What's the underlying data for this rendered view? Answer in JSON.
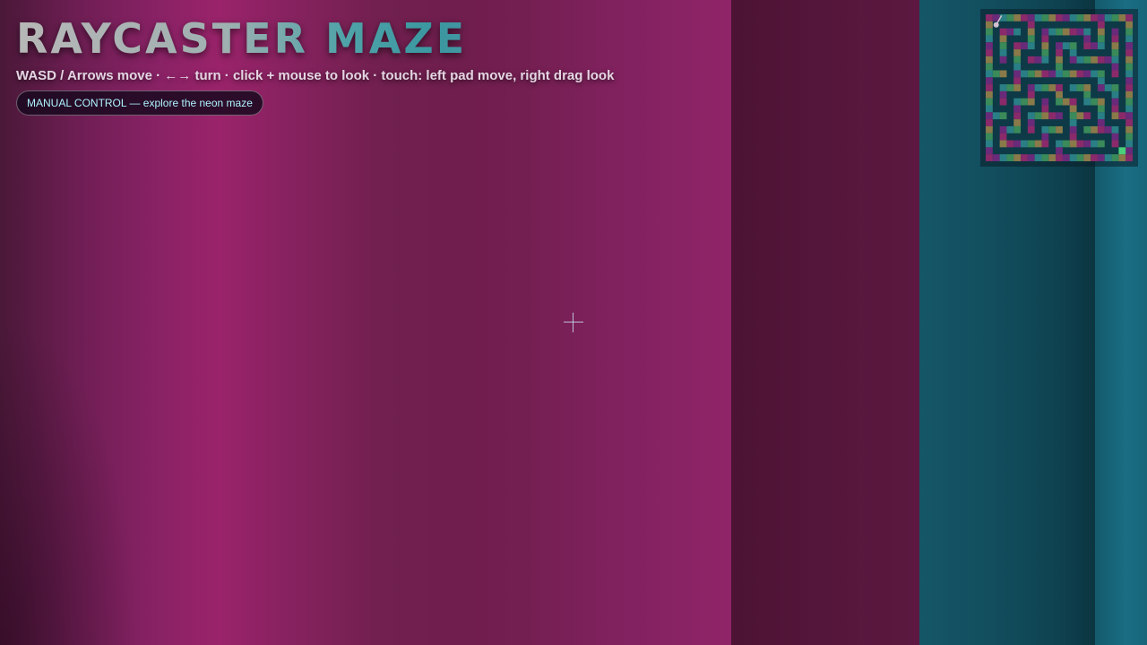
{
  "game": {
    "title": "RAYCASTER MAZE",
    "controls_help": "WASD / Arrows move · ←→ turn · click + mouse to look · touch: left pad move, right drag look",
    "mode_badge": "MANUAL CONTROL — explore the neon maze"
  },
  "colors": {
    "wall_magenta": "#9a236a",
    "wall_teal": "#155667",
    "badge_text": "#aef3ff",
    "minimap_path": "#0d3a46",
    "minimap_wall_colors": [
      "#8a2a6a",
      "#2a7f86",
      "#8a7a4a",
      "#6a2a7a",
      "#3a8a5a"
    ],
    "player_marker": "#d0c0d0",
    "exit_marker": "#4ad07a"
  },
  "minimap": {
    "grid_size": 21,
    "wall_map": [
      "111111111111111111111",
      "100000100000000010001",
      "101110101111111010101",
      "101000101000001010101",
      "101011101011101110101",
      "101010001010100000101",
      "101010111010111111101",
      "100010000010000000101",
      "111011111111111110101",
      "100010000000000010001",
      "101110111110111011101",
      "101000100010001000101",
      "101011101011101110101",
      "100010001000100010101",
      "111010111110111010111",
      "100010100000100010001",
      "101110101110101111101",
      "101000001000100000101",
      "101111111011111110101",
      "100000000010000000001",
      "111111111111111111111"
    ],
    "player": {
      "row": 1,
      "col": 1,
      "heading_deg": -60
    },
    "exit": {
      "row": 19,
      "col": 19
    }
  },
  "crosshair_icon": "crosshair-icon"
}
